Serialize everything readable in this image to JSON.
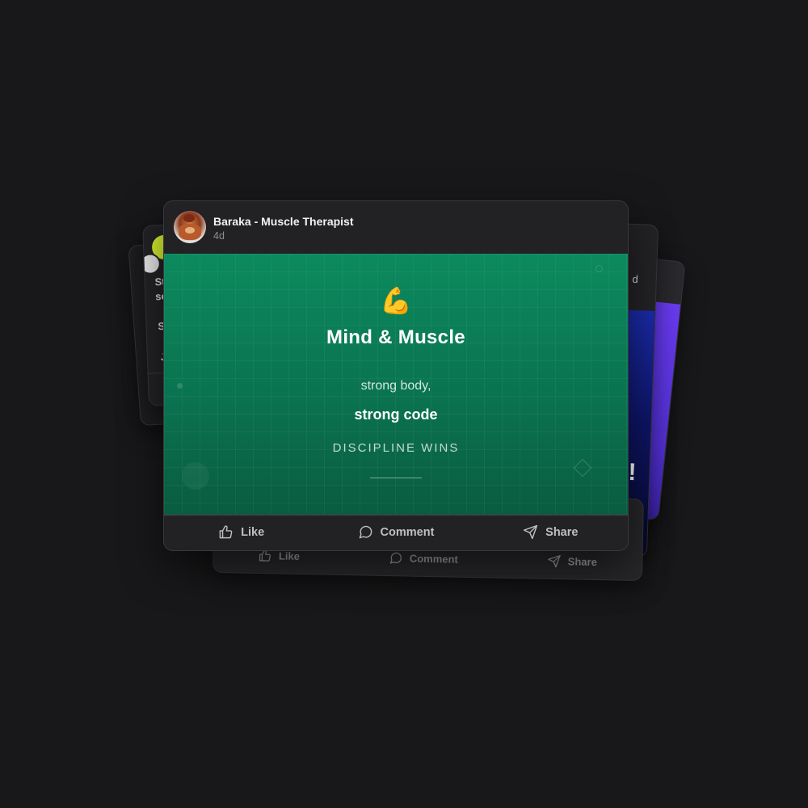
{
  "post": {
    "author": "Baraka - Muscle Therapist",
    "timestamp": "4d",
    "media": {
      "emoji": "💪",
      "title": "Mind & Muscle",
      "line1": "strong body,",
      "line2": "strong code",
      "line3": "DISCIPLINE WINS"
    },
    "actions": {
      "like": "Like",
      "comment": "Comment",
      "share": "Share"
    }
  },
  "background_cards": {
    "left_fragments": [
      "St",
      "se",
      "S",
      "J"
    ],
    "right_fragment": "d",
    "right_exclaim": "!",
    "bottom_actions": {
      "like": "Like",
      "comment": "Comment",
      "share": "Share"
    }
  },
  "colors": {
    "page_bg": "#18181a",
    "card_bg": "#222225",
    "media_green": "#0a7350",
    "accent_yellow": "#d7f230",
    "accent_purple": "#6a3bf0",
    "accent_blue": "#1a2ba8"
  },
  "icons": [
    "thumbs-up-icon",
    "comment-bubble-icon",
    "paper-plane-icon",
    "flexed-biceps-emoji"
  ]
}
